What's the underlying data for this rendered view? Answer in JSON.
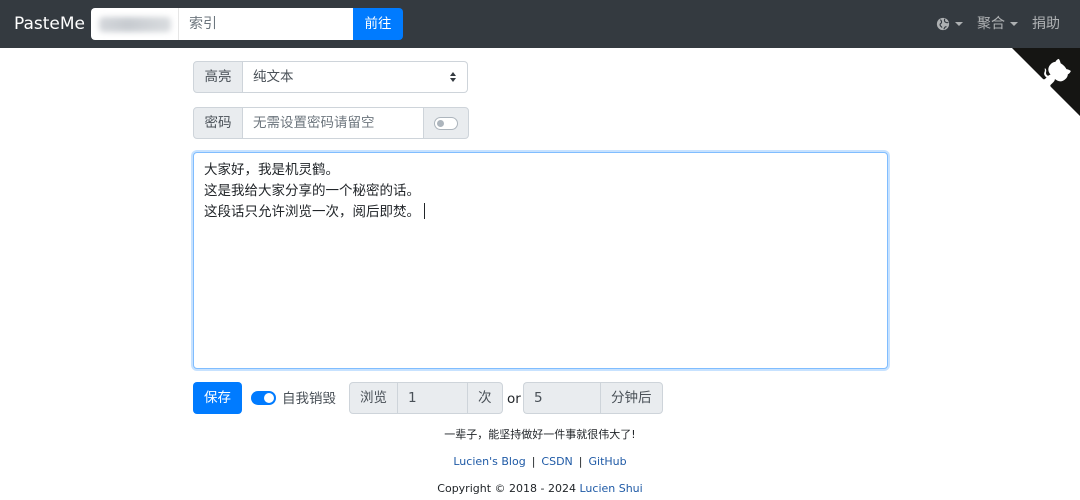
{
  "navbar": {
    "brand": "PasteMe",
    "search_placeholder": "索引",
    "go_button": "前往",
    "aggregate_label": "聚合",
    "donate_label": "捐助"
  },
  "form": {
    "highlight_label": "高亮",
    "highlight_selected": "纯文本",
    "password_label": "密码",
    "password_placeholder": "无需设置密码请留空",
    "content_lines": [
      "大家好，我是机灵鹤。",
      "这是我给大家分享的一个秘密的话。",
      "这段话只允许浏览一次，阅后即焚。"
    ],
    "save_button": "保存",
    "self_destroy_label": "自我销毁",
    "self_destroy_enabled": true,
    "password_toggle_enabled": false,
    "views_label": "浏览",
    "views_value": "1",
    "views_unit": "次",
    "or_text": "or",
    "minutes_value": "5",
    "minutes_unit": "分钟后"
  },
  "footer": {
    "motto": "一辈子，能坚持做好一件事就很伟大了!",
    "links": [
      "Lucien's Blog",
      "CSDN",
      "GitHub"
    ],
    "link_separator": "|",
    "copyright_prefix": "Copyright © 2018 - 2024 ",
    "copyright_author": "Lucien Shui"
  },
  "icons": {
    "language": "globe-icon",
    "corner": "github-octocat-icon",
    "select_arrows": "sort-arrows-icon"
  },
  "colors": {
    "navbar_bg": "#343a40",
    "primary": "#007bff"
  }
}
